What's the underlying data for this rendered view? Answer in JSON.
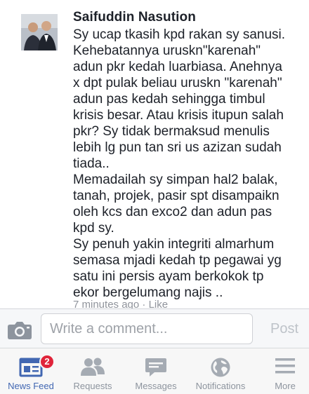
{
  "post": {
    "author": "Saifuddin Nasution",
    "body_lines": [
      "Sy ucap tkasih kpd rakan sy sanusi.",
      "Kehebatannya uruskn\"karenah\"",
      "adun pkr kedah luarbiasa. Anehnya",
      "x dpt pulak beliau uruskn \"karenah\"",
      "adun pas kedah sehingga timbul",
      "krisis besar. Atau krisis itupun salah",
      "pkr? Sy tidak bermaksud menulis",
      "lebih lg pun tan sri us azizan sudah",
      "tiada..",
      "Memadailah sy simpan hal2 balak,",
      "tanah, projek, pasir spt disampaikn",
      "oleh kcs dan exco2 dan adun pas",
      "kpd sy.",
      "Sy penuh yakin integriti almarhum",
      "semasa mjadi kedah tp pegawai yg",
      "satu ini persis ayam berkokok tp",
      "ekor bergelumang najis .."
    ],
    "timestamp": "7 minutes ago",
    "separator": " · ",
    "like_label": "Like"
  },
  "composer": {
    "placeholder": "Write a comment...",
    "post_label": "Post"
  },
  "tabs": [
    {
      "label": "News Feed",
      "icon": "news-feed-icon",
      "badge": "2"
    },
    {
      "label": "Requests",
      "icon": "friend-requests-icon"
    },
    {
      "label": "Messages",
      "icon": "messages-icon"
    },
    {
      "label": "Notifications",
      "icon": "globe-icon"
    },
    {
      "label": "More",
      "icon": "menu-icon"
    }
  ],
  "colors": {
    "accent": "#4267b2",
    "badge": "#e0243a",
    "inactive": "#8d949e"
  }
}
